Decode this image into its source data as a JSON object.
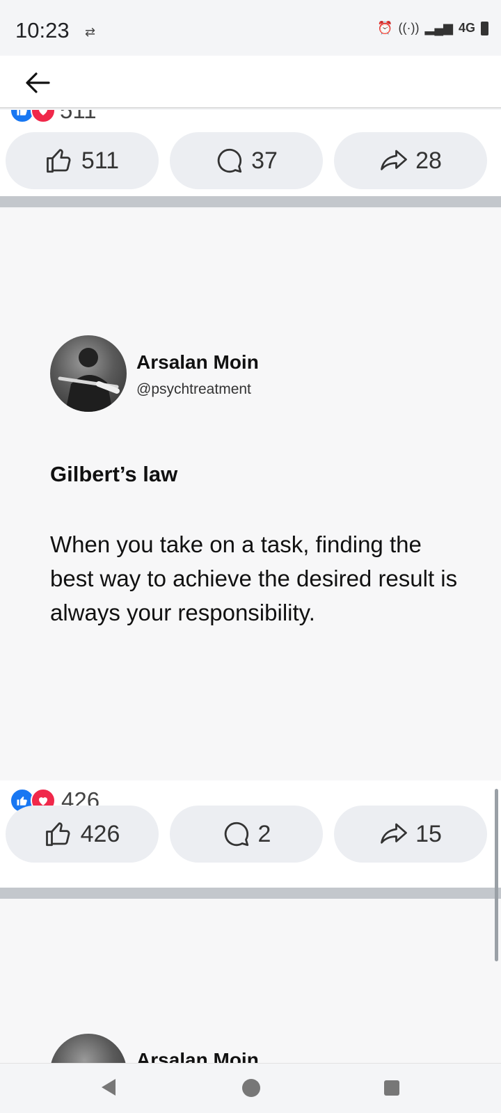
{
  "status_bar": {
    "time": "10:23",
    "network": "4G",
    "icons": [
      "data-arrows-icon",
      "alarm-icon",
      "hotspot-icon",
      "signal-icon",
      "battery-icon"
    ]
  },
  "app_bar": {
    "back_icon": "back-arrow-icon"
  },
  "previous_post": {
    "reaction_count": "511",
    "like_count": "511",
    "comment_count": "37",
    "share_count": "28"
  },
  "post": {
    "author_name": "Arsalan Moin",
    "author_handle": "@psychtreatment",
    "quote_title": "Gilbert’s law",
    "quote_body": "When you take on a task, finding the best way to achieve the desired result is always your responsibility.",
    "reaction_count": "426",
    "like_count": "426",
    "comment_count": "2",
    "share_count": "15"
  },
  "next_post": {
    "author_name": "Arsalan Moin"
  },
  "colors": {
    "like_blue": "#1877f2",
    "love_red": "#f0284a",
    "button_bg": "#eceef2"
  }
}
